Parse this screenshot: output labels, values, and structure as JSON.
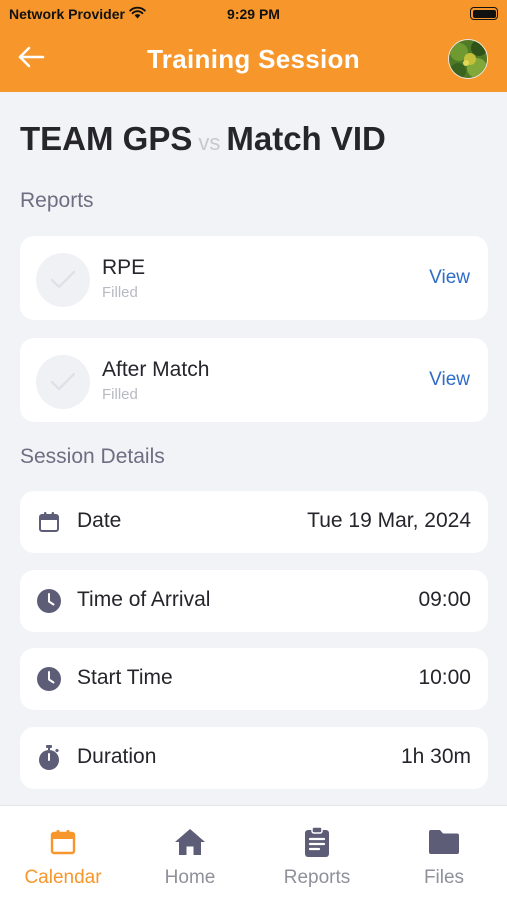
{
  "status_bar": {
    "carrier": "Network Provider",
    "time": "9:29 PM"
  },
  "header": {
    "title": "Training Session",
    "back_icon": "arrow-left-icon",
    "avatar_icon": "avatar"
  },
  "match": {
    "team_home": "TEAM GPS",
    "vs": "vs",
    "team_away": "Match VID"
  },
  "reports": {
    "label": "Reports",
    "items": [
      {
        "name": "RPE",
        "status": "Filled",
        "action": "View"
      },
      {
        "name": "After Match",
        "status": "Filled",
        "action": "View"
      }
    ]
  },
  "session_details": {
    "label": "Session Details",
    "items": [
      {
        "label": "Date",
        "value": "Tue 19 Mar, 2024",
        "icon": "calendar-icon"
      },
      {
        "label": "Time of Arrival",
        "value": "09:00",
        "icon": "clock-icon"
      },
      {
        "label": "Start Time",
        "value": "10:00",
        "icon": "clock-icon"
      },
      {
        "label": "Duration",
        "value": "1h 30m",
        "icon": "stopwatch-icon"
      }
    ]
  },
  "tabs": [
    {
      "label": "Calendar",
      "icon": "calendar-icon",
      "active": true
    },
    {
      "label": "Home",
      "icon": "home-icon",
      "active": false
    },
    {
      "label": "Reports",
      "icon": "clipboard-icon",
      "active": false
    },
    {
      "label": "Files",
      "icon": "folder-icon",
      "active": false
    }
  ],
  "colors": {
    "accent": "#f7962a",
    "link": "#2e6cc8",
    "icon": "#5d5d77",
    "muted_text": "#6d6e82"
  }
}
